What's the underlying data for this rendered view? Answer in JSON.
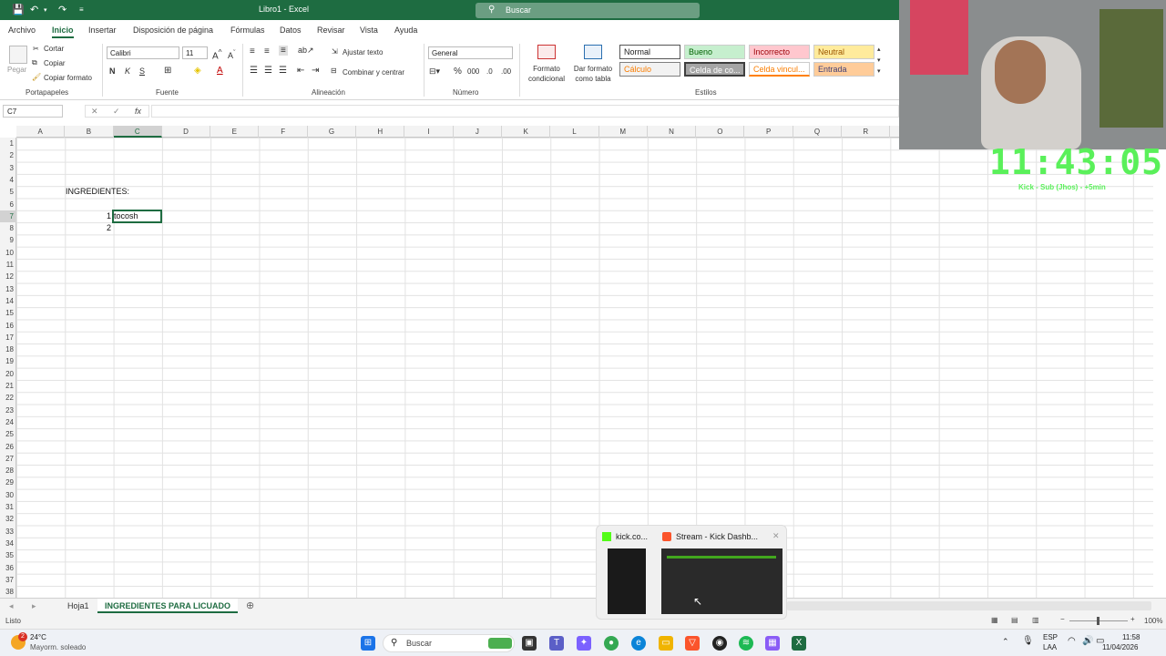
{
  "titlebar": {
    "doc_title": "Libro1  -  Excel",
    "search_label": "Buscar",
    "accent": "#1e6c41"
  },
  "menu": [
    "Archivo",
    "Inicio",
    "Insertar",
    "Disposición de página",
    "Fórmulas",
    "Datos",
    "Revisar",
    "Vista",
    "Ayuda"
  ],
  "ribbon": {
    "clipboard": {
      "paste": "Pegar",
      "cut": "Cortar",
      "copy": "Copiar",
      "format_painter": "Copiar formato",
      "group": "Portapapeles"
    },
    "font": {
      "name": "Calibri",
      "size": "11",
      "bold": "N",
      "italic": "K",
      "underline": "S",
      "group": "Fuente"
    },
    "alignment": {
      "wrap": "Ajustar texto",
      "merge": "Combinar y centrar",
      "group": "Alineación"
    },
    "number": {
      "format": "General",
      "group": "Número"
    },
    "cond_format": "Formato condicional",
    "table_format": "Dar formato como tabla",
    "styles": {
      "group": "Estilos",
      "items": [
        "Normal",
        "Bueno",
        "Incorrecto",
        "Neutral",
        "Cálculo",
        "Celda de co...",
        "Celda vincul...",
        "Entrada"
      ]
    }
  },
  "formula_bar": {
    "name_box": "C7",
    "fx": "fx",
    "value": ""
  },
  "columns": [
    "A",
    "B",
    "C",
    "D",
    "E",
    "F",
    "G",
    "H",
    "I",
    "J",
    "K",
    "L",
    "M",
    "N",
    "O",
    "P",
    "Q",
    "R"
  ],
  "rows": [
    "1",
    "2",
    "3",
    "4",
    "5",
    "6",
    "7",
    "8",
    "9",
    "10",
    "11",
    "12",
    "13",
    "14",
    "15",
    "16",
    "17",
    "18",
    "19",
    "20",
    "21",
    "22",
    "23",
    "24",
    "25",
    "26",
    "27",
    "28",
    "29",
    "30",
    "31",
    "32",
    "33",
    "34",
    "35",
    "36",
    "37",
    "38"
  ],
  "cells": {
    "b4": "INGREDIENTES:",
    "b6": "1",
    "c6": "tocosh",
    "b7": "2"
  },
  "sheets": [
    "Hoja1",
    "INGREDIENTES PARA LICUADO"
  ],
  "status": {
    "ready": "Listo",
    "zoom": "100%"
  },
  "taskbar": {
    "weather_temp": "24°C",
    "weather_desc": "Mayorm. soleado",
    "weather_badge": "2",
    "search": "Buscar",
    "lang1": "ESP",
    "lang2": "LAA",
    "time": "11:58",
    "date": "11/04/2026"
  },
  "preview": {
    "tab1": "kick.co...",
    "tab2": "Stream - Kick Dashb..."
  },
  "overlay": {
    "clock": "11:43:05",
    "subtitle": "Kick - Sub (Jhos) - +5min"
  }
}
